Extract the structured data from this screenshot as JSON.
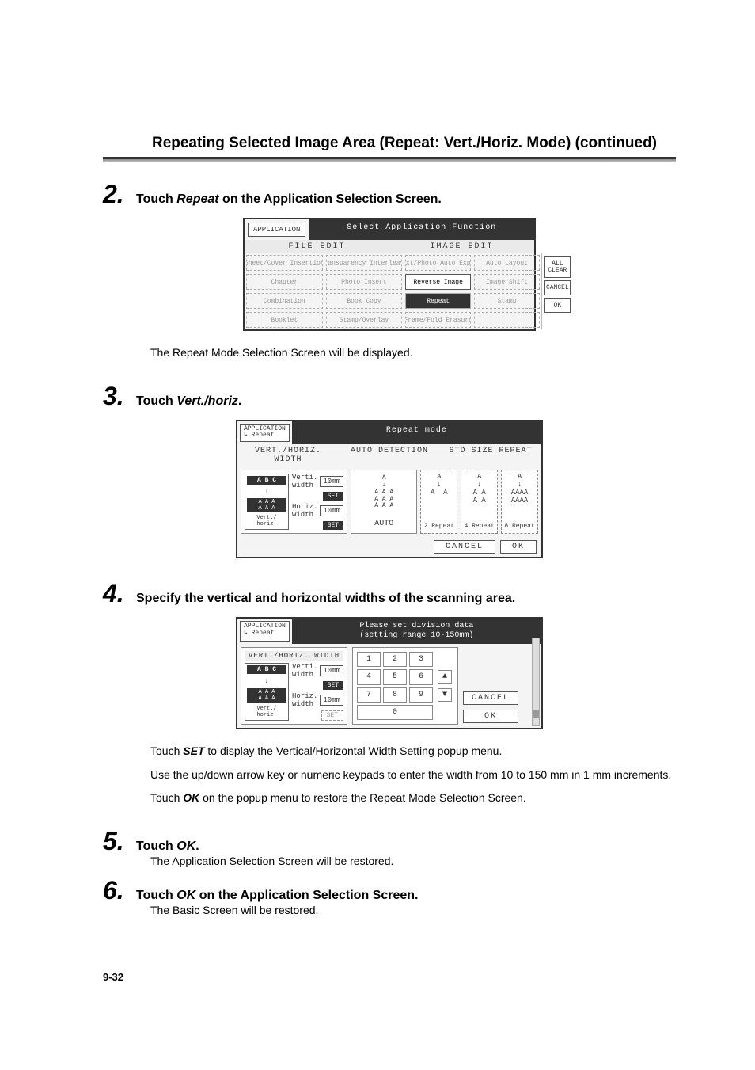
{
  "header": {
    "title_prefix": "Repeating Selected Image Area (Repeat: Vert./Horiz. Mode)",
    "title_suffix": " (continued)"
  },
  "steps": {
    "s2": {
      "num": "2.",
      "instruction_pre": "Touch ",
      "instruction_em": "Repeat",
      "instruction_post": " on the Application Selection Screen.",
      "caption": "The Repeat Mode Selection Screen will be displayed."
    },
    "s3": {
      "num": "3.",
      "instruction_pre": "Touch ",
      "instruction_em": "Vert./horiz",
      "instruction_post": "."
    },
    "s4": {
      "num": "4.",
      "instruction": "Specify the vertical and horizontal widths of the scanning area.",
      "body": {
        "p1_pre": "Touch ",
        "p1_em": "SET",
        "p1_post": " to display the Vertical/Horizontal Width Setting popup menu.",
        "p2": "Use the up/down arrow key or numeric keypads to enter the width from 10 to 150 mm in 1 mm increments.",
        "p3_pre": "Touch ",
        "p3_em": "OK",
        "p3_post": " on the popup menu to restore the Repeat Mode Selection Screen."
      }
    },
    "s5": {
      "num": "5.",
      "instruction_pre": "Touch ",
      "instruction_em": "OK",
      "instruction_post": ".",
      "body": "The Application Selection Screen will be restored."
    },
    "s6": {
      "num": "6.",
      "instruction_pre": "Touch ",
      "instruction_em": "OK",
      "instruction_post": " on the Application Selection Screen.",
      "body": "The Basic Screen will be restored."
    }
  },
  "screen_a": {
    "chip": "APPLICATION",
    "title": "Select Application Function",
    "headings": {
      "left": "FILE EDIT",
      "right": "IMAGE EDIT"
    },
    "cells": {
      "r1c1": "Sheet/Cover Insertion",
      "r1c2": "Transparency Interleave",
      "r1c3": "Text/Photo Auto Expo.",
      "r1c4": "Auto Layout",
      "r2c1": "Chapter",
      "r2c2": "Photo Insert",
      "r2c3": "Reverse Image",
      "r2c4": "Image Shift",
      "r3c1": "Combination",
      "r3c2": "Book Copy",
      "r3c3": "Repeat",
      "r3c4": "Stamp",
      "r4c1": "Booklet",
      "r4c2": "Stamp/Overlay",
      "r4c3": "Frame/Fold Erasure",
      "r4c4": ""
    },
    "buttons": {
      "allclear": "ALL CLEAR",
      "cancel": "CANCEL",
      "ok": "OK"
    }
  },
  "screen_b": {
    "chip_line1": "APPLICATION",
    "chip_line2": "↳ Repeat",
    "title": "Repeat mode",
    "headers": {
      "h1": "VERT./HORIZ. WIDTH",
      "h2": "AUTO DETECTION",
      "h3": "STD SIZE REPEAT"
    },
    "verthoriz": {
      "preview_abc": "A B C",
      "preview_aaa": "A A A\nA A A",
      "preview_lbl": "Vert./\nhoriz.",
      "verti_label": "Verti.\nwidth",
      "horiz_label": "Horiz.\nwidth",
      "value": "10",
      "unit": "mm",
      "set": "SET"
    },
    "auto": {
      "label": "AUTO",
      "glyph": "A\n↓\nA A A\nA A A\nA A A"
    },
    "repeatboxes": {
      "b2": {
        "label": "2 Repeat",
        "glyph": "A\n↓\nA  A"
      },
      "b4": {
        "label": "4 Repeat",
        "glyph": "A\n↓\nA A\nA A"
      },
      "b8": {
        "label": "8 Repeat",
        "glyph": "A\n↓\nAAAA\nAAAA"
      }
    },
    "footer": {
      "cancel": "CANCEL",
      "ok": "OK"
    }
  },
  "screen_c": {
    "chip_line1": "APPLICATION",
    "chip_line2": "↳ Repeat",
    "title_line1": "Please set division data",
    "title_line2": "(setting range 10-150mm)",
    "left_header": "VERT./HORIZ. WIDTH",
    "preview_abc": "A B C",
    "preview_aaa": "A A A\nA A A",
    "preview_lbl": "Vert./\nhoriz.",
    "verti_label": "Verti.\nwidth",
    "horiz_label": "Horiz.\nwidth",
    "value": "10",
    "unit": "mm",
    "set": "SET",
    "keys": {
      "1": "1",
      "2": "2",
      "3": "3",
      "4": "4",
      "5": "5",
      "6": "6",
      "7": "7",
      "8": "8",
      "9": "9",
      "0": "0"
    },
    "arrows": {
      "up": "▲",
      "down": "▼"
    },
    "buttons": {
      "cancel": "CANCEL",
      "ok": "OK"
    }
  },
  "page_num": "9-32"
}
